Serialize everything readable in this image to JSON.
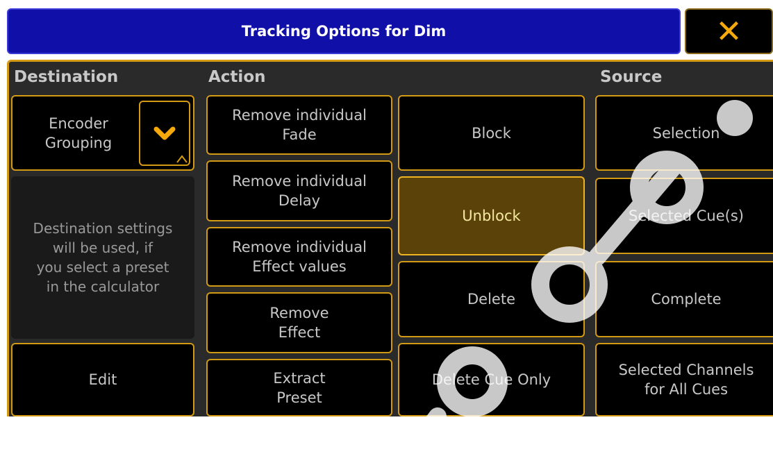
{
  "window": {
    "title": "Tracking Options for Dim",
    "close_symbol": "✕"
  },
  "headers": {
    "destination": "Destination",
    "action": "Action",
    "source": "Source"
  },
  "destination": {
    "grouping_label": "Encoder\nGrouping",
    "dropdown_icon": "chevron-down-icon",
    "info_text": "Destination settings\nwill be used, if\nyou select a preset\nin the calculator",
    "edit_label": "Edit"
  },
  "actions_left": [
    {
      "label": "Remove individual\nFade"
    },
    {
      "label": "Remove individual\nDelay"
    },
    {
      "label": "Remove individual\nEffect values"
    },
    {
      "label": "Remove\nEffect"
    },
    {
      "label": "Extract\nPreset"
    }
  ],
  "actions_right": [
    {
      "label": "Block",
      "active": false
    },
    {
      "label": "Unblock",
      "active": true
    },
    {
      "label": "Delete",
      "active": false
    },
    {
      "label": "Delete Cue Only",
      "active": false
    }
  ],
  "sources": [
    {
      "label": "Selection"
    },
    {
      "label": "Selected Cue(s)"
    },
    {
      "label": "Complete"
    },
    {
      "label": "Selected Channels\nfor All Cues"
    }
  ],
  "colors": {
    "accent": "#d39a14",
    "title_bg": "#1010a8",
    "active_bg": "#5a4208",
    "panel_bg": "#2a2a2a"
  }
}
